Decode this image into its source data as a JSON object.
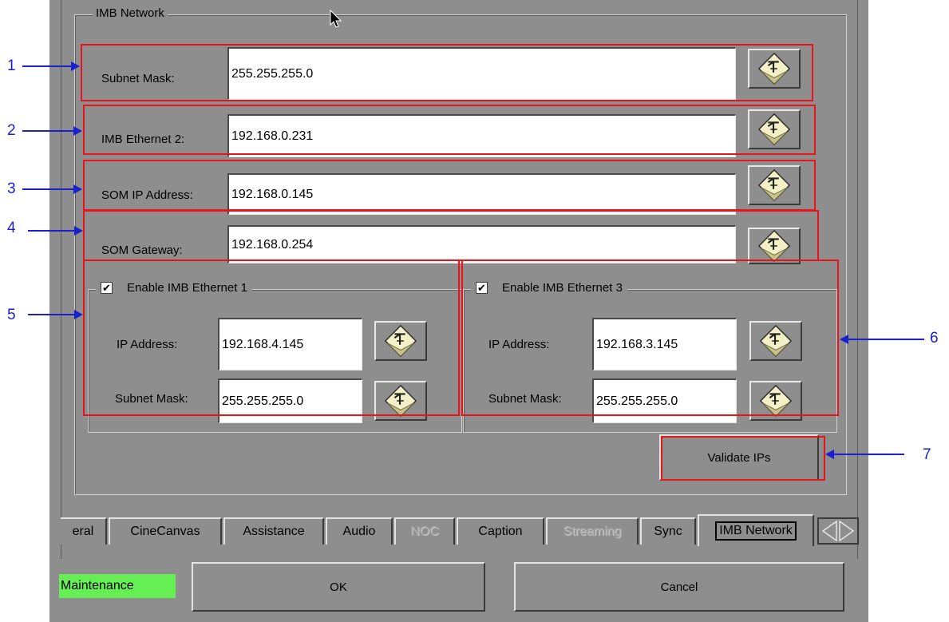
{
  "group_title": "IMB Network",
  "rows": {
    "subnet_mask": {
      "label": "Subnet Mask:",
      "value": "255.255.255.0"
    },
    "imb_ethernet2": {
      "label": "IMB Ethernet 2:",
      "value": "192.168.0.231"
    },
    "som_ip": {
      "label": "SOM IP Address:",
      "value": "192.168.0.145"
    },
    "som_gateway": {
      "label": "SOM Gateway:",
      "value": "192.168.0.254"
    }
  },
  "eth1": {
    "title": "Enable IMB Ethernet 1",
    "checked": "✔",
    "ip_label": "IP Address:",
    "ip_value": "192.168.4.145",
    "mask_label": "Subnet Mask:",
    "mask_value": "255.255.255.0"
  },
  "eth3": {
    "title": "Enable IMB Ethernet 3",
    "checked": "✔",
    "ip_label": "IP Address:",
    "ip_value": "192.168.3.145",
    "mask_label": "Subnet Mask:",
    "mask_value": "255.255.255.0"
  },
  "validate_label": "Validate IPs",
  "tabs": [
    {
      "label": "eral",
      "state": "normal"
    },
    {
      "label": "CineCanvas",
      "state": "normal"
    },
    {
      "label": "Assistance",
      "state": "normal"
    },
    {
      "label": "Audio",
      "state": "normal"
    },
    {
      "label": "NOC",
      "state": "disabled"
    },
    {
      "label": "Caption",
      "state": "normal"
    },
    {
      "label": "Streaming",
      "state": "disabled"
    },
    {
      "label": "Sync",
      "state": "normal"
    },
    {
      "label": "IMB Network",
      "state": "active"
    }
  ],
  "status_label": "Maintenance",
  "ok_label": "OK",
  "cancel_label": "Cancel",
  "callouts": [
    "1",
    "2",
    "3",
    "4",
    "5",
    "6",
    "7"
  ],
  "colors": {
    "highlight": "#e8141a",
    "callout": "#1a1fcf",
    "status_bg": "#66ee55",
    "panel": "#8e8e8e"
  }
}
